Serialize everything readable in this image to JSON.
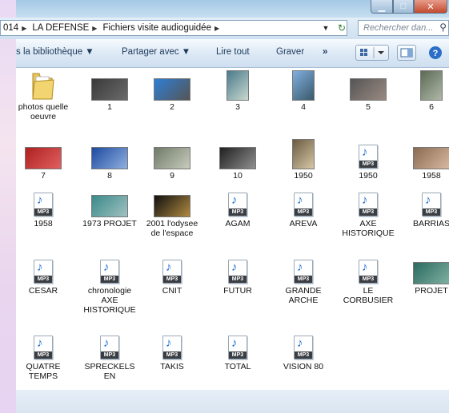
{
  "window": {
    "buttons": {
      "minimize": "▁",
      "maximize": "□",
      "close": "✕"
    },
    "close_color": "#c3492f"
  },
  "address": {
    "path_prefix": "014",
    "crumbs": [
      "LA DEFENSE",
      "Fichiers visite audioguidée"
    ],
    "search_placeholder": "Rechercher dan..."
  },
  "toolbar": {
    "library": "s la bibliothèque ▼",
    "share": "Partager avec ▼",
    "play": "Lire tout",
    "burn": "Graver",
    "more": "»"
  },
  "icons": {
    "folder": "folder-icon",
    "image": "image-thumbnail",
    "audio": "mp3-file-icon"
  },
  "files": [
    {
      "name": "photos quelle oeuvre",
      "kind": "folder"
    },
    {
      "name": "1",
      "kind": "image",
      "colors": [
        "#3a3a3a",
        "#6a6a6a"
      ]
    },
    {
      "name": "2",
      "kind": "image",
      "colors": [
        "#2f7fd6",
        "#555"
      ]
    },
    {
      "name": "3",
      "kind": "image",
      "colors": [
        "#4a7a8a",
        "#c8d8d0"
      ]
    },
    {
      "name": "4",
      "kind": "image",
      "colors": [
        "#7faee0",
        "#3a5a6a"
      ]
    },
    {
      "name": "5",
      "kind": "image",
      "colors": [
        "#555",
        "#9a8a82"
      ]
    },
    {
      "name": "6",
      "kind": "image",
      "colors": [
        "#5a6a55",
        "#b0b8a8"
      ]
    },
    {
      "name": "7",
      "kind": "image",
      "colors": [
        "#b02020",
        "#e06060"
      ]
    },
    {
      "name": "8",
      "kind": "image",
      "colors": [
        "#1e4aa0",
        "#8fb0e0"
      ]
    },
    {
      "name": "9",
      "kind": "image",
      "colors": [
        "#707a68",
        "#c8ccbe"
      ]
    },
    {
      "name": "10",
      "kind": "image",
      "colors": [
        "#202020",
        "#909090"
      ]
    },
    {
      "name": "1950",
      "kind": "image",
      "colors": [
        "#6a5a40",
        "#d8c8a8"
      ]
    },
    {
      "name": "1950",
      "kind": "audio"
    },
    {
      "name": "1958",
      "kind": "image",
      "colors": [
        "#8a6a50",
        "#d8b8a0"
      ]
    },
    {
      "name": "1958",
      "kind": "audio"
    },
    {
      "name": "1973 PROJET",
      "kind": "image",
      "colors": [
        "#3a8a8a",
        "#a0c0c0"
      ]
    },
    {
      "name": "2001 l'odysee de l'espace",
      "kind": "image",
      "colors": [
        "#101010",
        "#b08a40"
      ]
    },
    {
      "name": "AGAM",
      "kind": "audio"
    },
    {
      "name": "AREVA",
      "kind": "audio"
    },
    {
      "name": "AXE HISTORIQUE",
      "kind": "audio"
    },
    {
      "name": "BARRIAS",
      "kind": "audio"
    },
    {
      "name": "CESAR",
      "kind": "audio"
    },
    {
      "name": "chronologie AXE HISTORIQUE",
      "kind": "audio"
    },
    {
      "name": "CNIT",
      "kind": "audio"
    },
    {
      "name": "FUTUR",
      "kind": "audio"
    },
    {
      "name": "GRANDE ARCHE",
      "kind": "audio"
    },
    {
      "name": "LE CORBUSIER",
      "kind": "audio"
    },
    {
      "name": "PROJET",
      "kind": "image",
      "colors": [
        "#2a6a60",
        "#7fb0a0"
      ]
    },
    {
      "name": "QUATRE TEMPS",
      "kind": "audio"
    },
    {
      "name": "SPRECKELSEN",
      "kind": "audio"
    },
    {
      "name": "TAKIS",
      "kind": "audio"
    },
    {
      "name": "TOTAL",
      "kind": "audio"
    },
    {
      "name": "VISION 80",
      "kind": "audio"
    }
  ]
}
